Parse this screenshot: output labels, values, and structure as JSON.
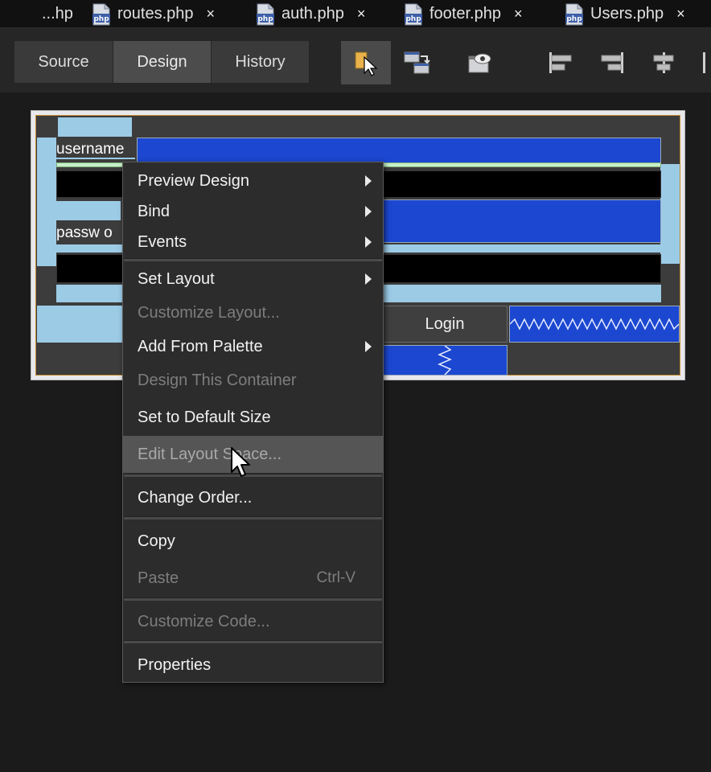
{
  "tabs": [
    {
      "label": "...hp",
      "closable": false
    },
    {
      "label": "routes.php",
      "closable": true
    },
    {
      "label": "auth.php",
      "closable": true
    },
    {
      "label": "footer.php",
      "closable": true
    },
    {
      "label": "Users.php",
      "closable": true
    }
  ],
  "tab_close_glyph": "×",
  "php_icon_text": "php",
  "view_modes": {
    "source": "Source",
    "design": "Design",
    "history": "History",
    "active": "Design"
  },
  "toolbar_icons": [
    "selection-mode-icon",
    "connection-mode-icon",
    "preview-design-icon",
    "align-left-icon",
    "align-right-icon",
    "center-horizontally-icon",
    "align-more-icon"
  ],
  "form": {
    "username_label": "username",
    "password_label": "passw o",
    "login_button": "Login"
  },
  "context_menu": {
    "preview_design": "Preview Design",
    "bind": "Bind",
    "events": "Events",
    "set_layout": "Set Layout",
    "customize_layout": "Customize Layout...",
    "add_from_palette": "Add From Palette",
    "design_this_container": "Design This Container",
    "set_default_size": "Set to Default Size",
    "edit_layout_space": "Edit Layout Space...",
    "change_order": "Change Order...",
    "copy": "Copy",
    "paste": "Paste",
    "paste_shortcut": "Ctrl-V",
    "customize_code": "Customize Code...",
    "properties": "Properties"
  },
  "colors": {
    "selection_blue": "#1c47d1",
    "light_blue": "#9ccbe6",
    "menu_bg": "#2c2c2c",
    "menu_hover": "#555555",
    "selection_border": "#c58a2e"
  }
}
